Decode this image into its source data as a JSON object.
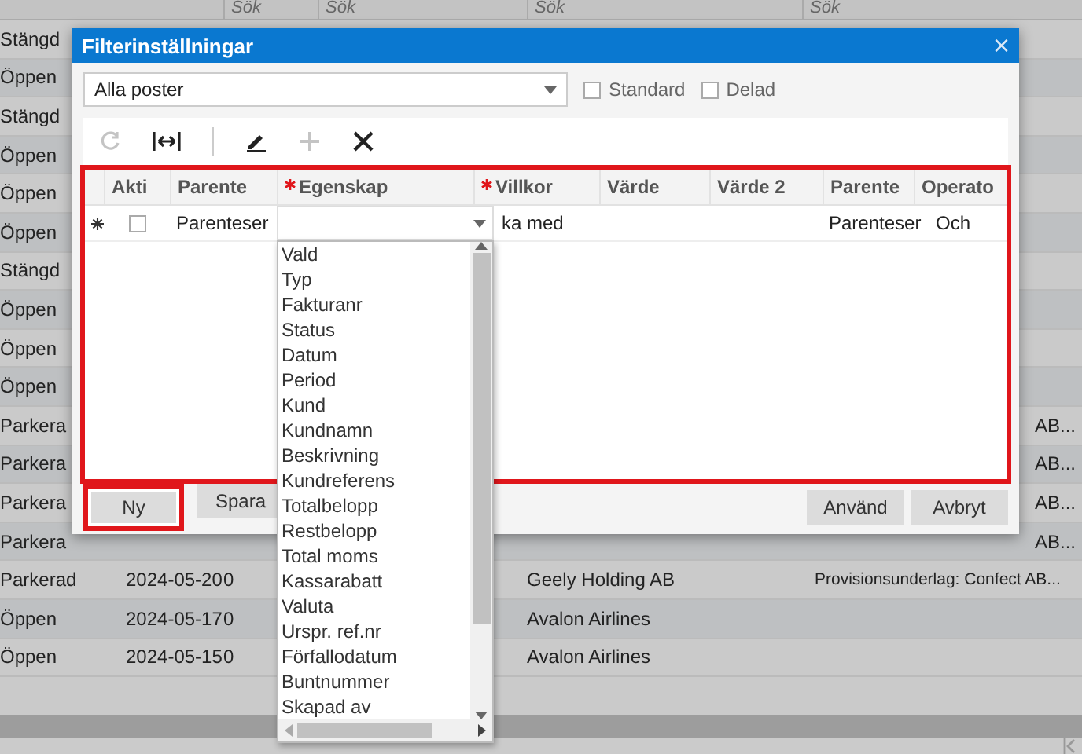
{
  "background_table": {
    "filter_cells": [
      "Sök",
      "Sök",
      "Sök",
      "Sök"
    ],
    "rows": [
      {
        "status": "Stängd"
      },
      {
        "status": "Öppen"
      },
      {
        "status": "Stängd"
      },
      {
        "status": "Öppen"
      },
      {
        "status": "Öppen"
      },
      {
        "status": "Öppen"
      },
      {
        "status": "Stängd"
      },
      {
        "status": "Öppen"
      },
      {
        "status": "Öppen"
      },
      {
        "status": "Öppen"
      },
      {
        "status": "Parkera",
        "description": "AB..."
      },
      {
        "status": "Parkera",
        "description": "AB..."
      },
      {
        "status": "Parkera",
        "description": "AB..."
      },
      {
        "status": "Parkera",
        "description": "AB..."
      },
      {
        "status": "Parkerad",
        "date": "2024-05-20",
        "number": "0",
        "customer": "Geely Holding AB",
        "description": "Provisionsunderlag: Confect AB..."
      },
      {
        "status": "Öppen",
        "date": "2024-05-17",
        "number": "0",
        "customer": "Avalon Airlines"
      },
      {
        "status": "Öppen",
        "date": "2024-05-15",
        "number": "0",
        "customer": "Avalon Airlines"
      }
    ]
  },
  "dialog": {
    "title": "Filterinställningar",
    "close": "×",
    "filter_select": {
      "value": "Alla poster"
    },
    "checkboxes": [
      {
        "label": "Standard",
        "checked": false
      },
      {
        "label": "Delad",
        "checked": false
      }
    ],
    "toolbar": [
      {
        "kind": "refresh",
        "disabled": true
      },
      {
        "kind": "fit-width",
        "disabled": false
      },
      {
        "kind": "separator"
      },
      {
        "kind": "edit",
        "disabled": false
      },
      {
        "kind": "add",
        "disabled": true
      },
      {
        "kind": "delete",
        "disabled": false
      }
    ],
    "grid": {
      "highlighted": true,
      "columns": [
        {
          "label": "Akti",
          "required": false
        },
        {
          "label": "Parente",
          "required": false
        },
        {
          "label": "Egenskap",
          "required": true
        },
        {
          "label": "Villkor",
          "required": true
        },
        {
          "label": "Värde",
          "required": false
        },
        {
          "label": "Värde 2",
          "required": false
        },
        {
          "label": "Parente",
          "required": false
        },
        {
          "label": "Operato",
          "required": false
        }
      ],
      "rows": [
        {
          "new_row": true,
          "active": false,
          "open_parenthesis": "Parenteser",
          "property_expanded": true,
          "condition": "ka med",
          "close_parenthesis": "Parenteser",
          "operator": "Och"
        }
      ]
    },
    "property_options": [
      "Vald",
      "Typ",
      "Fakturanr",
      "Status",
      "Datum",
      "Period",
      "Kund",
      "Kundnamn",
      "Beskrivning",
      "Kundreferens",
      "Totalbelopp",
      "Restbelopp",
      "Total moms",
      "Kassarabatt",
      "Valuta",
      "Urspr. ref.nr",
      "Förfallodatum",
      "Buntnummer",
      "Skapad av"
    ],
    "buttons_left": [
      {
        "label": "Ny",
        "highlighted": true
      },
      {
        "label": "Spara",
        "highlighted": false
      }
    ],
    "buttons_right": [
      {
        "label": "Använd",
        "highlighted": false
      },
      {
        "label": "Avbryt",
        "highlighted": false
      }
    ]
  }
}
